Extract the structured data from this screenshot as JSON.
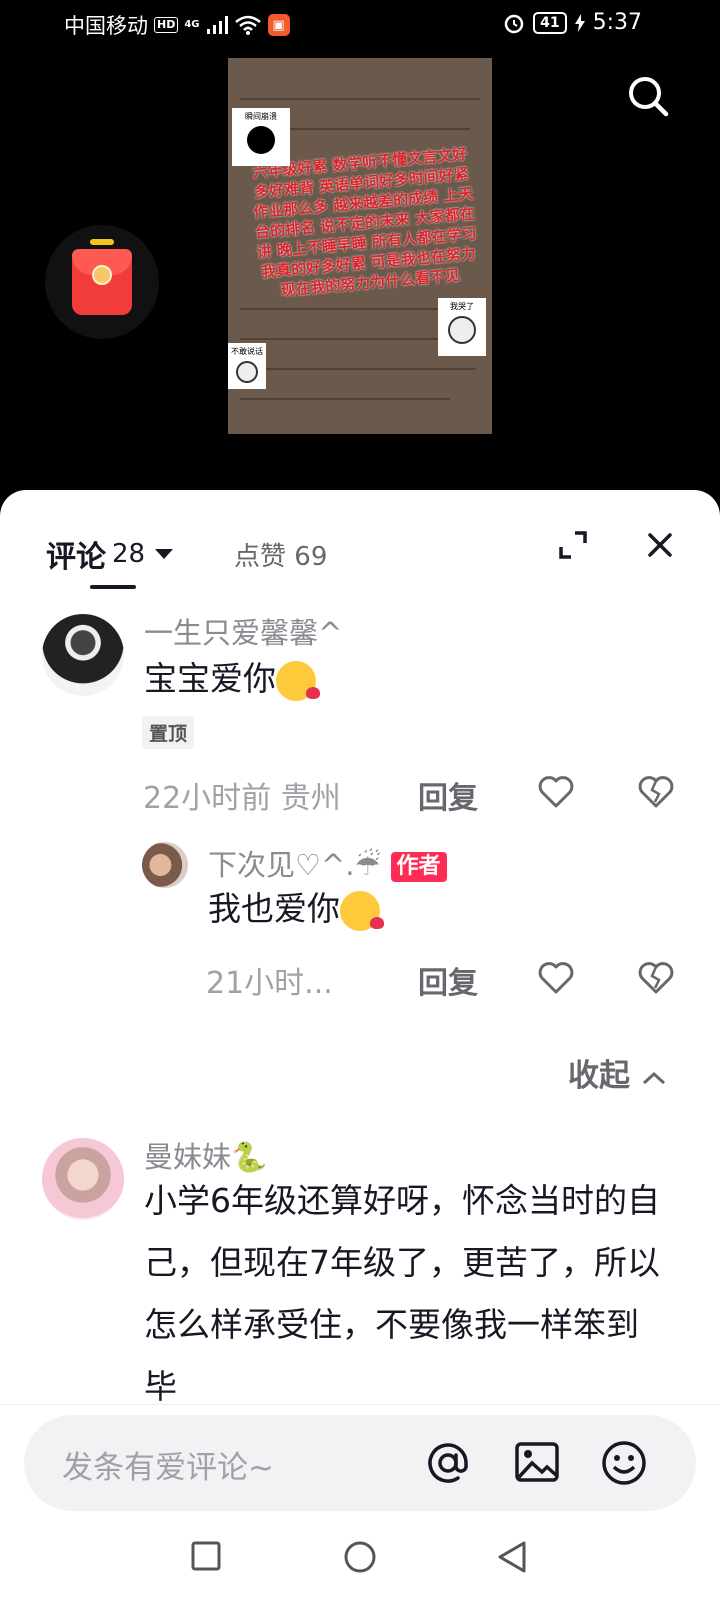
{
  "status_bar": {
    "carrier": "中国移动",
    "hd": "HD",
    "network": "4G",
    "battery": "41",
    "time": "5:37"
  },
  "video": {
    "overlay_text": "六年级好累 数学听不懂文言文好多好难背 英语单词好多时间好紧 作业那么多 越来越差的成绩 上天台的排名 说不定的未来 大家都在讲 晚上不睡早睡 所有人都在学习 我真的好多好累 可是我也在努力 现在我的努力为什么看不见",
    "sticker_top": "瞬间崩溃",
    "sticker_right": "我哭了",
    "sticker_left": "不敢说话"
  },
  "comments_tab": {
    "label": "评论",
    "count": "28",
    "likes_label": "点赞",
    "likes_count": "69"
  },
  "comments": [
    {
      "username": "一生只爱馨馨^",
      "text": "宝宝爱你",
      "pinned_label": "置顶",
      "time_location": "22小时前 贵州",
      "reply_label": "回复"
    },
    {
      "username": "下次见♡^.☔",
      "author_badge": "作者",
      "text": "我也爱你",
      "time_location": "21小时...",
      "reply_label": "回复"
    },
    {
      "username": "曼妹妹🐍",
      "text": "小学6年级还算好呀，怀念当时的自己，但现在7年级了，更苦了，所以怎么样承受住，不要像我一样笨到毕"
    }
  ],
  "collapse_label": "收起",
  "input": {
    "placeholder": "发条有爱评论~"
  },
  "icons": {
    "search": "search-icon",
    "red_packet": "red-packet-icon",
    "expand": "expand-icon",
    "close": "close-icon",
    "heart": "heart-icon",
    "dislike": "broken-heart-icon",
    "mention": "at-icon",
    "image": "image-icon",
    "emoji": "emoji-icon"
  },
  "colors": {
    "author_badge": "#fe2c55",
    "primary_text": "#161823",
    "secondary_text": "#8a8b91"
  }
}
